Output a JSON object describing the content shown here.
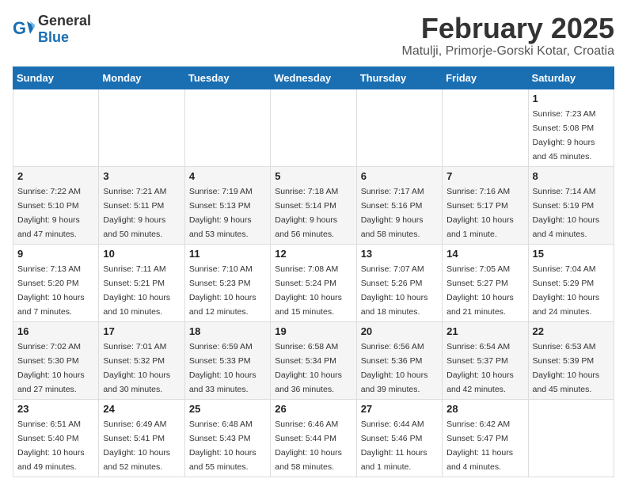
{
  "header": {
    "logo_general": "General",
    "logo_blue": "Blue",
    "title": "February 2025",
    "subtitle": "Matulji, Primorje-Gorski Kotar, Croatia"
  },
  "weekdays": [
    "Sunday",
    "Monday",
    "Tuesday",
    "Wednesday",
    "Thursday",
    "Friday",
    "Saturday"
  ],
  "weeks": [
    [
      {
        "day": "",
        "info": ""
      },
      {
        "day": "",
        "info": ""
      },
      {
        "day": "",
        "info": ""
      },
      {
        "day": "",
        "info": ""
      },
      {
        "day": "",
        "info": ""
      },
      {
        "day": "",
        "info": ""
      },
      {
        "day": "1",
        "info": "Sunrise: 7:23 AM\nSunset: 5:08 PM\nDaylight: 9 hours and 45 minutes."
      }
    ],
    [
      {
        "day": "2",
        "info": "Sunrise: 7:22 AM\nSunset: 5:10 PM\nDaylight: 9 hours and 47 minutes."
      },
      {
        "day": "3",
        "info": "Sunrise: 7:21 AM\nSunset: 5:11 PM\nDaylight: 9 hours and 50 minutes."
      },
      {
        "day": "4",
        "info": "Sunrise: 7:19 AM\nSunset: 5:13 PM\nDaylight: 9 hours and 53 minutes."
      },
      {
        "day": "5",
        "info": "Sunrise: 7:18 AM\nSunset: 5:14 PM\nDaylight: 9 hours and 56 minutes."
      },
      {
        "day": "6",
        "info": "Sunrise: 7:17 AM\nSunset: 5:16 PM\nDaylight: 9 hours and 58 minutes."
      },
      {
        "day": "7",
        "info": "Sunrise: 7:16 AM\nSunset: 5:17 PM\nDaylight: 10 hours and 1 minute."
      },
      {
        "day": "8",
        "info": "Sunrise: 7:14 AM\nSunset: 5:19 PM\nDaylight: 10 hours and 4 minutes."
      }
    ],
    [
      {
        "day": "9",
        "info": "Sunrise: 7:13 AM\nSunset: 5:20 PM\nDaylight: 10 hours and 7 minutes."
      },
      {
        "day": "10",
        "info": "Sunrise: 7:11 AM\nSunset: 5:21 PM\nDaylight: 10 hours and 10 minutes."
      },
      {
        "day": "11",
        "info": "Sunrise: 7:10 AM\nSunset: 5:23 PM\nDaylight: 10 hours and 12 minutes."
      },
      {
        "day": "12",
        "info": "Sunrise: 7:08 AM\nSunset: 5:24 PM\nDaylight: 10 hours and 15 minutes."
      },
      {
        "day": "13",
        "info": "Sunrise: 7:07 AM\nSunset: 5:26 PM\nDaylight: 10 hours and 18 minutes."
      },
      {
        "day": "14",
        "info": "Sunrise: 7:05 AM\nSunset: 5:27 PM\nDaylight: 10 hours and 21 minutes."
      },
      {
        "day": "15",
        "info": "Sunrise: 7:04 AM\nSunset: 5:29 PM\nDaylight: 10 hours and 24 minutes."
      }
    ],
    [
      {
        "day": "16",
        "info": "Sunrise: 7:02 AM\nSunset: 5:30 PM\nDaylight: 10 hours and 27 minutes."
      },
      {
        "day": "17",
        "info": "Sunrise: 7:01 AM\nSunset: 5:32 PM\nDaylight: 10 hours and 30 minutes."
      },
      {
        "day": "18",
        "info": "Sunrise: 6:59 AM\nSunset: 5:33 PM\nDaylight: 10 hours and 33 minutes."
      },
      {
        "day": "19",
        "info": "Sunrise: 6:58 AM\nSunset: 5:34 PM\nDaylight: 10 hours and 36 minutes."
      },
      {
        "day": "20",
        "info": "Sunrise: 6:56 AM\nSunset: 5:36 PM\nDaylight: 10 hours and 39 minutes."
      },
      {
        "day": "21",
        "info": "Sunrise: 6:54 AM\nSunset: 5:37 PM\nDaylight: 10 hours and 42 minutes."
      },
      {
        "day": "22",
        "info": "Sunrise: 6:53 AM\nSunset: 5:39 PM\nDaylight: 10 hours and 45 minutes."
      }
    ],
    [
      {
        "day": "23",
        "info": "Sunrise: 6:51 AM\nSunset: 5:40 PM\nDaylight: 10 hours and 49 minutes."
      },
      {
        "day": "24",
        "info": "Sunrise: 6:49 AM\nSunset: 5:41 PM\nDaylight: 10 hours and 52 minutes."
      },
      {
        "day": "25",
        "info": "Sunrise: 6:48 AM\nSunset: 5:43 PM\nDaylight: 10 hours and 55 minutes."
      },
      {
        "day": "26",
        "info": "Sunrise: 6:46 AM\nSunset: 5:44 PM\nDaylight: 10 hours and 58 minutes."
      },
      {
        "day": "27",
        "info": "Sunrise: 6:44 AM\nSunset: 5:46 PM\nDaylight: 11 hours and 1 minute."
      },
      {
        "day": "28",
        "info": "Sunrise: 6:42 AM\nSunset: 5:47 PM\nDaylight: 11 hours and 4 minutes."
      },
      {
        "day": "",
        "info": ""
      }
    ]
  ]
}
